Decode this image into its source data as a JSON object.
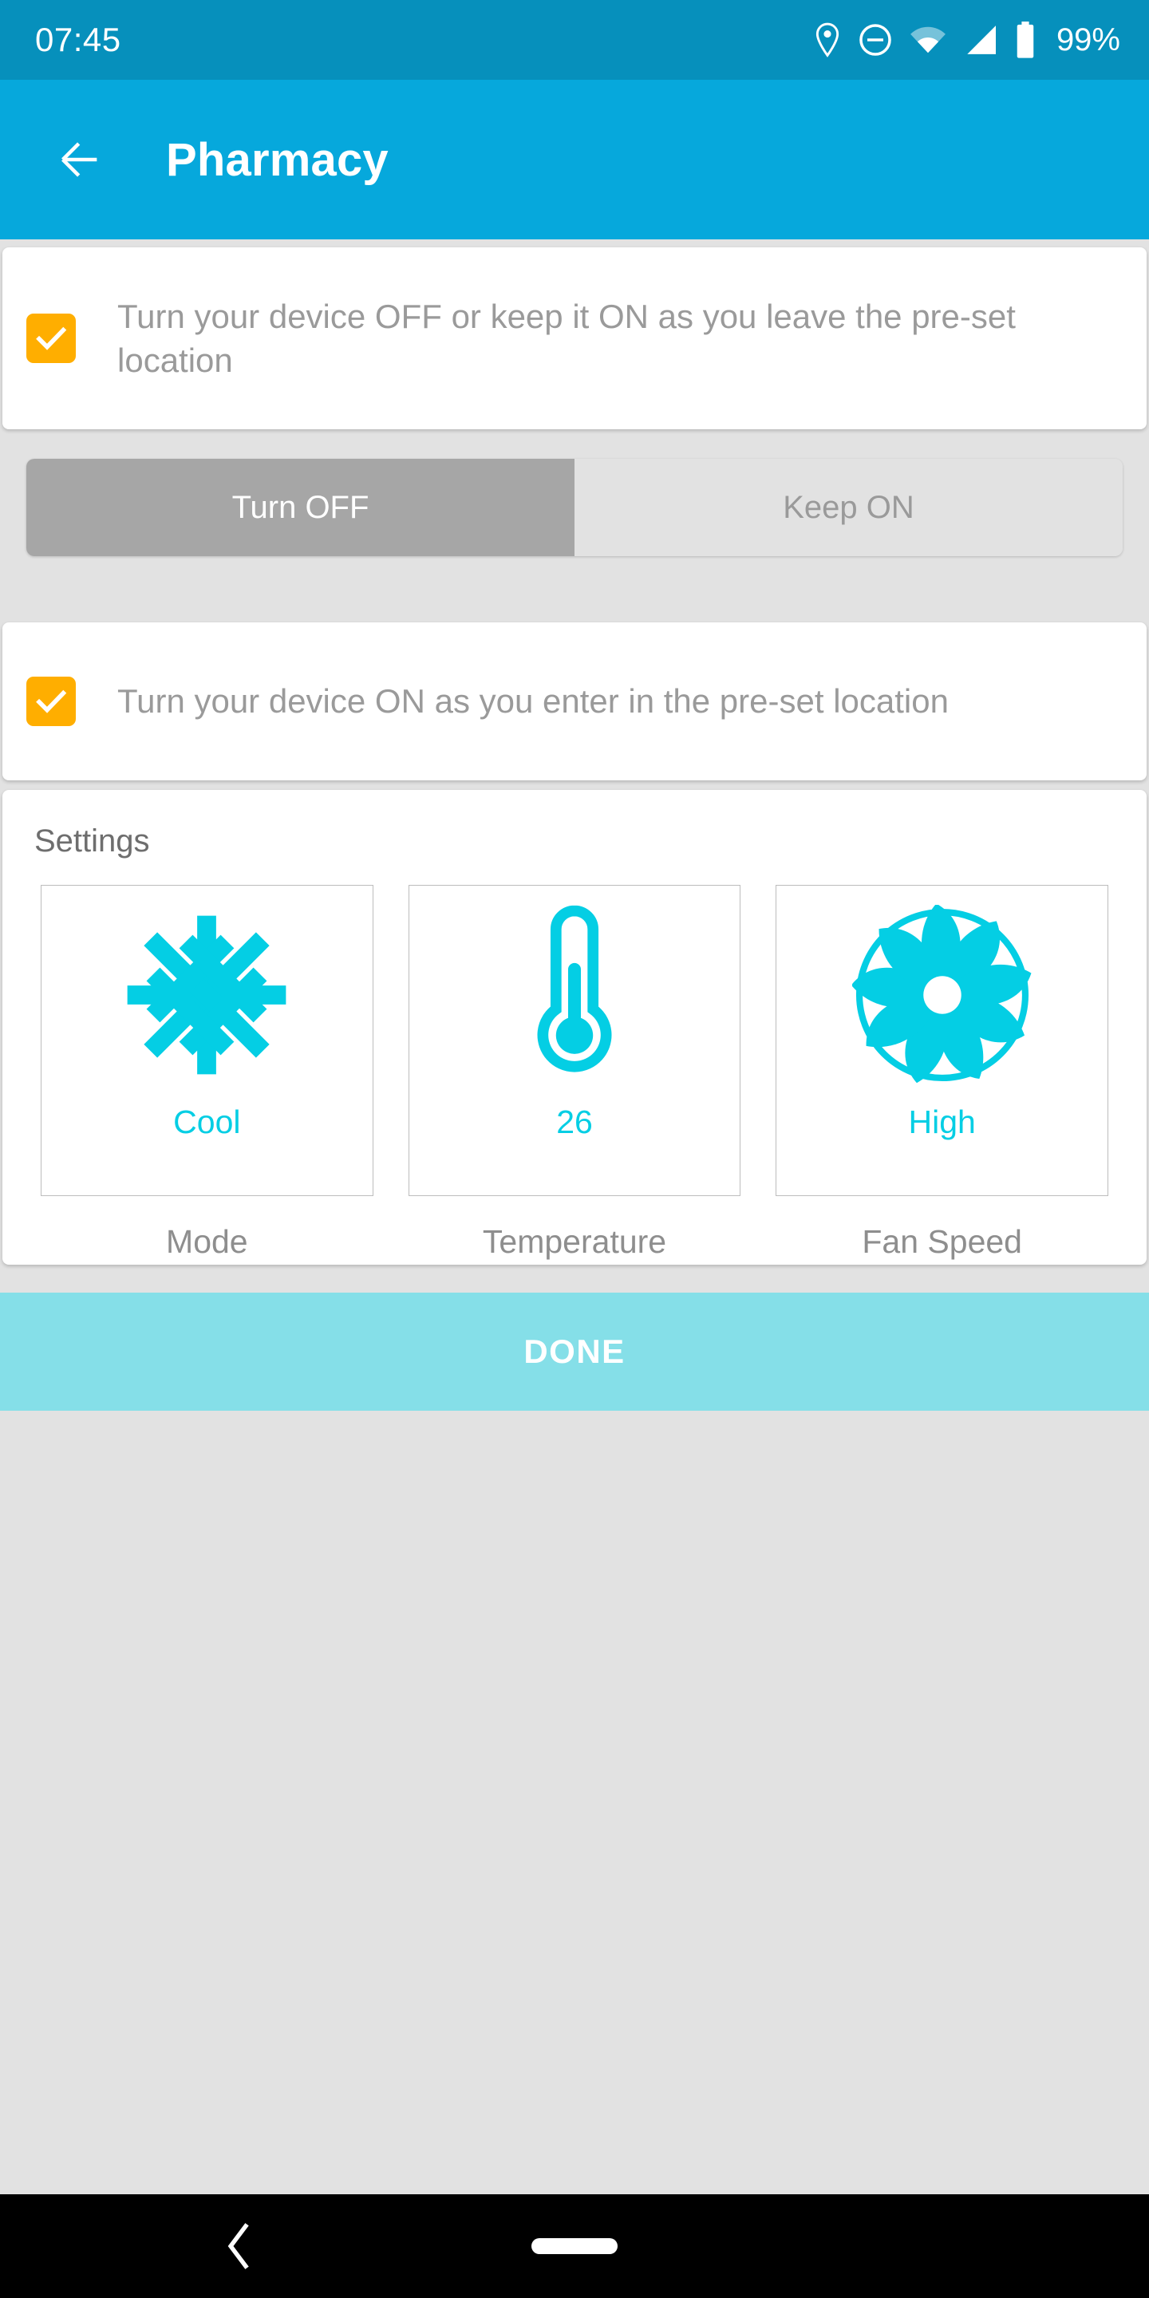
{
  "status_bar": {
    "time": "07:45",
    "battery_percent": "99%",
    "icons": [
      "location-pin-icon",
      "do-not-disturb-icon",
      "wifi-icon",
      "cellular-signal-icon",
      "battery-icon"
    ],
    "background_color": "#0690BC"
  },
  "app_bar": {
    "back_label": "back-arrow-icon",
    "title": "Pharmacy",
    "background_color": "#06A8DC"
  },
  "exit_rule": {
    "checked": true,
    "label": "Turn your device OFF or keep it ON as you leave the pre-set location",
    "checkbox_color": "#FFAE00"
  },
  "exit_toggle": {
    "options": [
      {
        "label": "Turn OFF",
        "selected": true
      },
      {
        "label": "Keep ON",
        "selected": false
      }
    ],
    "selected_color": "#A6A6A6",
    "unselected_color": "#E2E2E2"
  },
  "enter_rule": {
    "checked": true,
    "label": "Turn your device ON as you enter in the pre-set location",
    "checkbox_color": "#FFAE00"
  },
  "settings": {
    "title": "Settings",
    "accent_color": "#04CEE4",
    "tiles": [
      {
        "icon": "snowflake-icon",
        "value": "Cool",
        "caption": "Mode"
      },
      {
        "icon": "thermometer-icon",
        "value": "26",
        "caption": "Temperature"
      },
      {
        "icon": "fan-icon",
        "value": "High",
        "caption": "Fan Speed"
      }
    ]
  },
  "done_button": {
    "label": "DONE",
    "background_color": "#85DFE8"
  },
  "nav_bar": {
    "back": "nav-back-icon",
    "home": "nav-home-pill"
  }
}
